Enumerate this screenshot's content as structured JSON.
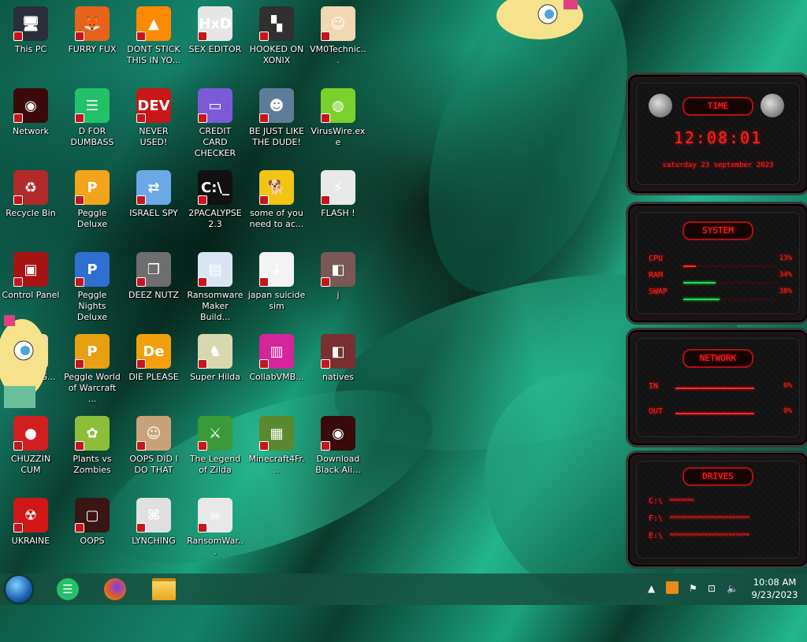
{
  "desktop_icons": [
    {
      "label": "This PC",
      "color": "#2a2f3a",
      "glyph": "🖥"
    },
    {
      "label": "FURRY FUX",
      "color": "#e8621a",
      "glyph": "🦊"
    },
    {
      "label": "DONT STICK THIS IN YO...",
      "color": "#ff8a00",
      "glyph": "▲"
    },
    {
      "label": "SEX EDITOR",
      "color": "#e6e6e6",
      "glyph": "HxD"
    },
    {
      "label": "HOOKED ON XONIX",
      "color": "#303030",
      "glyph": "▚"
    },
    {
      "label": "VM0Technic...",
      "color": "#f1d8b0",
      "glyph": "☺"
    },
    {
      "label": "Network",
      "color": "#3a0a0a",
      "glyph": "◉"
    },
    {
      "label": "D FOR DUMBASS",
      "color": "#23c167",
      "glyph": "☰"
    },
    {
      "label": "NEVER USED!",
      "color": "#c91616",
      "glyph": "DEV"
    },
    {
      "label": "CREDIT CARD CHECKER",
      "color": "#7c5ad6",
      "glyph": "▭"
    },
    {
      "label": "BE JUST LIKE THE DUDE!",
      "color": "#5c7d99",
      "glyph": "☻"
    },
    {
      "label": "VirusWire.exe",
      "color": "#7bd12c",
      "glyph": "◍"
    },
    {
      "label": "Recycle Bin",
      "color": "#b22a2a",
      "glyph": "♻"
    },
    {
      "label": "Peggle Deluxe",
      "color": "#f2a41a",
      "glyph": "P"
    },
    {
      "label": "ISRAEL SPY",
      "color": "#6aa8e8",
      "glyph": "⇄"
    },
    {
      "label": "2PACALYPSE 2.3",
      "color": "#111111",
      "glyph": "C:\\_"
    },
    {
      "label": "some of you need to ac...",
      "color": "#f2c414",
      "glyph": "🐕"
    },
    {
      "label": "FLASH !",
      "color": "#e9e9e9",
      "glyph": "⚡"
    },
    {
      "label": "Control Panel",
      "color": "#a81414",
      "glyph": "▣"
    },
    {
      "label": "Peggle Nights Deluxe",
      "color": "#2f6fd1",
      "glyph": "P"
    },
    {
      "label": "DEEZ NUTZ",
      "color": "#6e6e6e",
      "glyph": "❐"
    },
    {
      "label": "Ransomware Maker Build...",
      "color": "#d9e6f2",
      "glyph": "▤"
    },
    {
      "label": "japan suicide sim",
      "color": "#f4f4f4",
      "glyph": "⇣"
    },
    {
      "label": "j",
      "color": "#7a5858",
      "glyph": "◧"
    },
    {
      "label": "CCTS ING...",
      "color": "#f4d7a0",
      "glyph": "☺"
    },
    {
      "label": "Peggle World of Warcraft ...",
      "color": "#e8a012",
      "glyph": "P"
    },
    {
      "label": "DIE PLEASE",
      "color": "#f1a00b",
      "glyph": "De"
    },
    {
      "label": "Super Hilda",
      "color": "#d8d8b0",
      "glyph": "♞"
    },
    {
      "label": "CollabVMB...",
      "color": "#d6249a",
      "glyph": "▥"
    },
    {
      "label": "natives",
      "color": "#7a3030",
      "glyph": "◧"
    },
    {
      "label": "CHUZZIN CUM",
      "color": "#d11f1f",
      "glyph": "●"
    },
    {
      "label": "Plants vs Zombies",
      "color": "#8bbf3a",
      "glyph": "✿"
    },
    {
      "label": "OOPS DID I DO THAT",
      "color": "#c9a27a",
      "glyph": "☺"
    },
    {
      "label": "The Legend of Zilda",
      "color": "#3a9a3a",
      "glyph": "⚔"
    },
    {
      "label": "Minecraft4Fr...",
      "color": "#5b8a2e",
      "glyph": "▦"
    },
    {
      "label": "Download Black Ali...",
      "color": "#3a0a0a",
      "glyph": "◉"
    },
    {
      "label": "UKRAINE",
      "color": "#d01818",
      "glyph": "☢"
    },
    {
      "label": "OOPS",
      "color": "#3a1515",
      "glyph": "▢"
    },
    {
      "label": "LYNCHING",
      "color": "#e0e0e0",
      "glyph": "⌘"
    },
    {
      "label": "RansomWar...",
      "color": "#e8e8e8",
      "glyph": "☠"
    }
  ],
  "widget": {
    "time": {
      "header": "TIME",
      "clock": "12:08:01",
      "date": "saturday 23 september 2023"
    },
    "system": {
      "header": "SYSTEM",
      "rows": [
        {
          "label": "CPU",
          "value": "13%",
          "fraction": 0.13
        },
        {
          "label": "RAM",
          "value": "34%",
          "fraction": 0.34
        },
        {
          "label": "SWAP",
          "value": "38%",
          "fraction": 0.38
        }
      ]
    },
    "network": {
      "header": "NETWORK",
      "rows": [
        {
          "label": "IN",
          "value": "0%"
        },
        {
          "label": "OUT",
          "value": "0%"
        }
      ]
    },
    "drives": {
      "header": "DRIVES",
      "rows": [
        {
          "label": "C:\\",
          "fraction": 0.25
        },
        {
          "label": "F:\\",
          "fraction": 0.9
        },
        {
          "label": "E:\\",
          "fraction": 0.9
        }
      ]
    }
  },
  "taskbar": {
    "time": "10:08 AM",
    "date": "9/23/2023"
  }
}
